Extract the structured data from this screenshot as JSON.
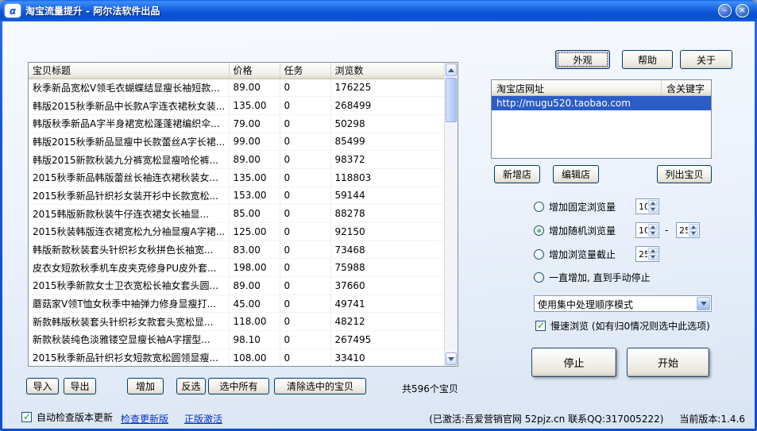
{
  "window": {
    "title": "淘宝流量提升 - 阿尔法软件出品",
    "icons": {
      "app": "α",
      "minimize": "–",
      "close": "×"
    }
  },
  "top_buttons": {
    "appearance": "外观",
    "help": "帮助",
    "about": "关于"
  },
  "items_table": {
    "columns": [
      "宝贝标题",
      "价格",
      "任务",
      "浏览数"
    ],
    "rows": [
      {
        "title": "秋季新品宽松V领毛衣蝴蝶结显瘦长袖短款...",
        "price": "89.00",
        "task": "0",
        "views": "176225"
      },
      {
        "title": "韩版2015秋季新品中长款A字连衣裙秋女装...",
        "price": "135.00",
        "task": "0",
        "views": "268499"
      },
      {
        "title": "韩版秋季新品A字半身裙宽松蓬蓬裙编织伞...",
        "price": "79.00",
        "task": "0",
        "views": "50298"
      },
      {
        "title": "韩版2015秋季新品显瘦中长款蕾丝A字长裙...",
        "price": "99.00",
        "task": "0",
        "views": "85499"
      },
      {
        "title": "韩版2015新款秋装九分裤宽松显瘦哈伦裤...",
        "price": "89.00",
        "task": "0",
        "views": "98372"
      },
      {
        "title": "2015秋季新品韩版蕾丝长袖连衣裙秋装女...",
        "price": "135.00",
        "task": "0",
        "views": "118803"
      },
      {
        "title": "2015秋季新品针织衫女装开衫中长款宽松...",
        "price": "153.00",
        "task": "0",
        "views": "59144"
      },
      {
        "title": "2015韩版新款秋装牛仔连衣裙女长袖显...",
        "price": "85.00",
        "task": "0",
        "views": "88278"
      },
      {
        "title": "2015秋装韩版连衣裙宽松九分袖显瘦A字裙...",
        "price": "125.00",
        "task": "0",
        "views": "92150"
      },
      {
        "title": "韩版新款秋装套头针织衫女秋拼色长袖宽...",
        "price": "83.00",
        "task": "0",
        "views": "73468"
      },
      {
        "title": "皮衣女短款秋季机车皮夹克修身PU皮外套...",
        "price": "198.00",
        "task": "0",
        "views": "75988"
      },
      {
        "title": "2015秋季新款女士卫衣宽松长袖女套头圆...",
        "price": "89.00",
        "task": "0",
        "views": "37660"
      },
      {
        "title": "蘑菇家V领T恤女秋季中袖弹力修身显瘦打...",
        "price": "45.00",
        "task": "0",
        "views": "49741"
      },
      {
        "title": "新款韩版秋装套头针织衫女款套头宽松显...",
        "price": "118.00",
        "task": "0",
        "views": "48212"
      },
      {
        "title": "新款秋装纯色淡雅镂空显瘦长袖A字摆型...",
        "price": "98.10",
        "task": "0",
        "views": "267495"
      },
      {
        "title": "2015秋季新品针织衫女短款宽松圆领显瘦...",
        "price": "108.00",
        "task": "0",
        "views": "33410"
      }
    ]
  },
  "table_footer": {
    "import": "导入",
    "export": "导出",
    "add": "增加",
    "invert": "反选",
    "select_all": "选中所有",
    "clear_selected": "清除选中的宝贝",
    "total": "共596个宝贝"
  },
  "store_list": {
    "columns": [
      "淘宝店网址",
      "含关键字"
    ],
    "rows": [
      {
        "url": "http://mugu520.taobao.com",
        "keyword": ""
      }
    ]
  },
  "store_buttons": {
    "add": "新增店",
    "edit": "编辑店",
    "list_items": "列出宝贝"
  },
  "controls": {
    "fixed_views": {
      "label": "增加固定浏览量",
      "value": "10"
    },
    "random_views": {
      "label": "增加随机浏览量",
      "min": "10",
      "max": "25",
      "separator": "-"
    },
    "views_cap": {
      "label": "增加浏览量截止",
      "value": "25"
    },
    "until_stop": {
      "label": "一直增加, 直到手动停止"
    },
    "mode_select": {
      "value": "使用集中处理顺序模式"
    },
    "slow_browse": {
      "label": "慢速浏览 (如有归0情况则选中此选项)"
    },
    "stop": "停止",
    "start": "开始"
  },
  "status_bar": {
    "auto_check": "自动检查版本更新",
    "check_update": "检查更新版",
    "activate": "正版激活",
    "activation_info": "(已激活:吾爱营销官网 52pjz.cn 联系QQ:317005222)",
    "version": "当前版本:1.4.6"
  },
  "colors": {
    "titlebar_blue": "#0c54d8",
    "selection_blue": "#2c5cc5",
    "check_green": "#21a121"
  }
}
